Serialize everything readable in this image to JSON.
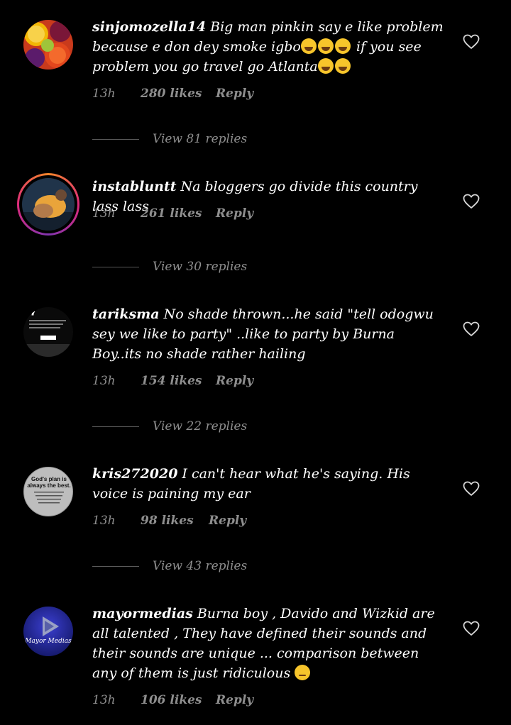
{
  "comments": [
    {
      "username": "sinjomozella14",
      "text_parts": [
        "Big man pinkin say e like problem because e don dey smoke igbo",
        " if you see problem you go travel go Atlanta",
        ""
      ],
      "emojis": [
        "rofl-emoji",
        "rofl-emoji"
      ],
      "time": "13h",
      "likes": "280 likes",
      "reply": "Reply",
      "view_replies": "View 81 replies"
    },
    {
      "username": "instabluntt",
      "text": "Na bloggers go divide this country lass lass",
      "time": "13h",
      "likes": "261 likes",
      "reply": "Reply",
      "view_replies": "View 30 replies"
    },
    {
      "username": "tariksma",
      "text": "No shade thrown...he said \"tell odogwu sey we like to party\" ..like to party by Burna Boy..its no shade rather hailing",
      "time": "13h",
      "likes": "154 likes",
      "reply": "Reply",
      "view_replies": "View 22 replies"
    },
    {
      "username": "kris272020",
      "text": "I can't hear what he's saying. His voice is paining my ear",
      "time": "13h",
      "likes": "98 likes",
      "reply": "Reply",
      "view_replies": "View 43 replies"
    },
    {
      "username": "mayormedias",
      "text": "Burna boy , Davido and Wizkid are all talented , They have defined their sounds and their sounds are unique ... comparison between any of them is just ridiculous ",
      "emoji": "pensive-emoji",
      "time": "13h",
      "likes": "106 likes",
      "reply": "Reply"
    }
  ],
  "avatars": {
    "tariksma_quote": "“",
    "kris_text": [
      "God's plan is",
      "always the best."
    ],
    "mayor_text": "Mayor Medias"
  },
  "colors": {
    "background": "#000000",
    "text": "#ffffff",
    "meta": "#8e8e8e"
  }
}
